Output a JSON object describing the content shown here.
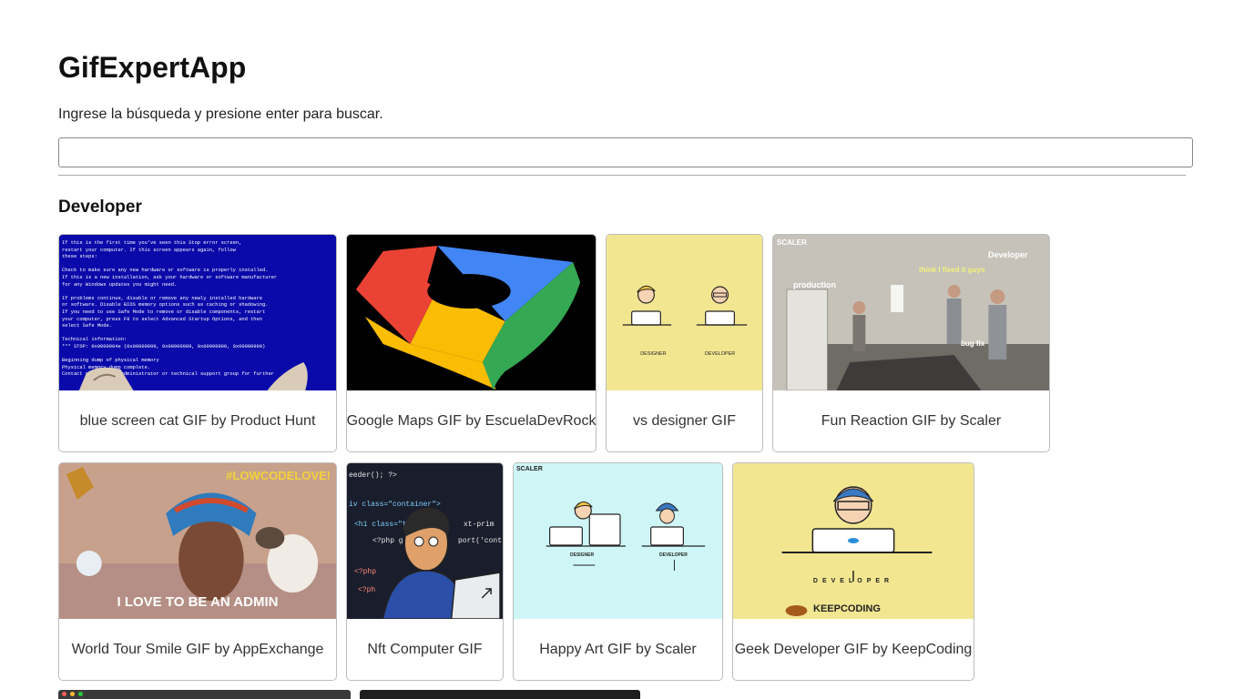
{
  "app": {
    "title": "GifExpertApp",
    "instruction": "Ingrese la búsqueda y presione enter para buscar.",
    "search": {
      "value": "",
      "placeholder": ""
    }
  },
  "category": {
    "title": "Developer",
    "gifs": [
      {
        "caption": "blue screen cat GIF by Product Hunt"
      },
      {
        "caption": "Google Maps GIF by EscuelaDevRock"
      },
      {
        "caption": "vs designer GIF"
      },
      {
        "caption": "Fun Reaction GIF by Scaler"
      },
      {
        "caption": "World Tour Smile GIF by AppExchange"
      },
      {
        "caption": "Nft Computer GIF"
      },
      {
        "caption": "Happy Art GIF by Scaler"
      },
      {
        "caption": "Geek Developer GIF by KeepCoding"
      }
    ]
  },
  "gif_text": {
    "bsod": "If this is the first time you've seen this Stop error screen,\nrestart your computer. If this screen appears again, follow\nthese steps:\n\nCheck to make sure any new hardware or software is properly installed.\nIf this is a new installation, ask your hardware or software manufacturer\nfor any Windows updates you might need.\n\nIf problems continue, disable or remove any newly installed hardware\nor software. Disable BIOS memory options such as caching or shadowing.\nIf you need to use Safe Mode to remove or disable components, restart\nyour computer, press F8 to select Advanced Startup Options, and then\nselect Safe Mode.\n\nTechnical information:\n*** STOP: 0x0000004e (0x00000099, 0x00900009, 0x00000900, 0x00000900)\n\nBeginning dump of physical memory\nPhysical memory dump complete.\nContact your system administrator or technical support group for further",
    "designer": "DESIGNER",
    "developer": "DEVELOPER",
    "scaler": "SCALER",
    "fun_developer": "Developer",
    "fun_fixed": "think I fixed it guys",
    "fun_production": "production",
    "fun_bugfix": "bug fix",
    "lowcode": "#LOWCODELOVE!",
    "admin": "I LOVE TO BE AN ADMIN",
    "code1": "eeder(); ?>",
    "code2": "iv class=\"container\">",
    "code3": "<h1 class=\"te",
    "code4": "xt-prim",
    "code5": "<?php g",
    "code6": "port('cont",
    "code7": "<?php",
    "code8": "<?ph",
    "keepcoding": "KEEPCODING"
  },
  "colors": {
    "bsod_blue": "#0a0aaa",
    "maps_red": "#ea4335",
    "maps_yellow": "#fbbc04",
    "maps_green": "#34a853",
    "maps_blue": "#4285f4",
    "pastel_yellow": "#f3e691",
    "light_cyan": "#cff6f6"
  }
}
